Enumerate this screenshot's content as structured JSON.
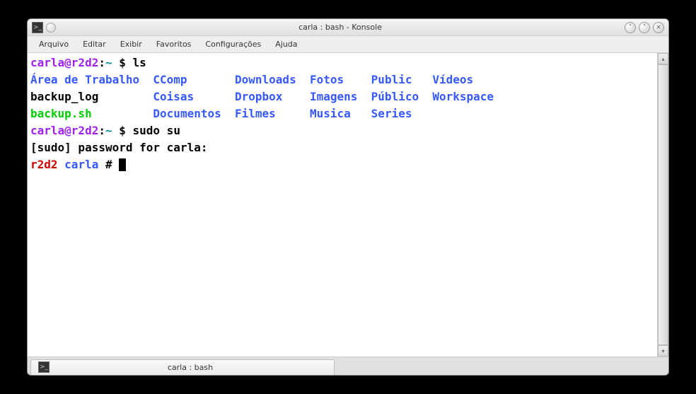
{
  "window": {
    "title": "carla : bash - Konsole"
  },
  "menu": {
    "arquivo": "Arquivo",
    "editar": "Editar",
    "exibir": "Exibir",
    "favoritos": "Favoritos",
    "configuracoes": "Configurações",
    "ajuda": "Ajuda"
  },
  "terminal": {
    "line1": {
      "user": "carla@r2d2",
      "sep": ":",
      "path": "~",
      "dollar": " $ ",
      "cmd": "ls"
    },
    "ls": {
      "c1r1": "Área de Trabalho",
      "c1r2": "backup_log",
      "c1r3": "backup.sh",
      "c2r1": "CComp",
      "c2r2": "Coisas",
      "c2r3": "Documentos",
      "c3r1": "Downloads",
      "c3r2": "Dropbox",
      "c3r3": "Filmes",
      "c4r1": "Fotos",
      "c4r2": "Imagens",
      "c4r3": "Musica",
      "c5r1": "Public",
      "c5r2": "Público",
      "c5r3": "Series",
      "c6r1": "Vídeos",
      "c6r2": "Workspace"
    },
    "line2": {
      "user": "carla@r2d2",
      "sep": ":",
      "path": "~",
      "dollar": " $ ",
      "cmd": "sudo su"
    },
    "line3": "[sudo] password for carla: ",
    "line4": {
      "host": "r2d2",
      "sp": " ",
      "dir": "carla",
      "hash": " # "
    }
  },
  "tab": {
    "label": "carla : bash"
  }
}
